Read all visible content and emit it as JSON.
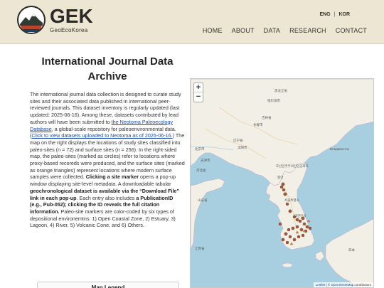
{
  "header": {
    "logo_title": "GEK",
    "logo_subtitle": "GeoEcoKorea",
    "lang": [
      "ENG",
      "KOR"
    ],
    "lang_sep": "|",
    "nav": [
      "HOME",
      "ABOUT",
      "DATA",
      "RESEARCH",
      "CONTACT"
    ]
  },
  "main": {
    "title": "International Journal Data Archive",
    "p1": "The international journal data collection is designed to curate study sites and their associated data published in international peer-reviewed journals. This dataset inventory is regularly updated (last updated: 2025-06-16). Among these, datasets contributed by lead authors will have been submitted to ",
    "neotoma_link": "the Neotoma Paleoecology Database",
    "p2": ", a global-scale repository for paleoenvironmental data. (",
    "neotoma_view_link": "Click to view datasets uploaded to Neotoma as of 2025-06-16.",
    "p3": ") The map on the right displays the locations of study sites classified into paleo-sites (n = 72) and surface sites (n = 256). In the right-sided map, the paleo-sites (marked as circles) refer to locations where proxy-based recoreds were produced, and the surface sites (marked as orange triangles) represent locations where modern surface samples were collected. ",
    "b1": "Clicking a site marker",
    "p4": " opens a pop-up window displaying site-level metadata. A downloadable tabular ",
    "b2": "geochronological dataset is available via the “Download File” link in each pop-up",
    "p5": ". Each entry also includes ",
    "b3": "a PublicationID (e.g., Pub-052); clicking the ID reveals the full citation information.",
    "p6": " Paleo-site markers are color-coded by six types of depositional environemtns: 1) Open Coastal Zone, 2) Estuary, 3) Lagoon, 4) River, 5) Volcanic Cone, and 6) Others.",
    "legend_heading": "Map Legend"
  },
  "map": {
    "zoom_in": "+",
    "zoom_out": "−",
    "attribution_leaflet": "Leaflet",
    "attribution_sep": " | © ",
    "attribution_osm": "OpenStreetMap",
    "attribution_tail": " contributors",
    "labels": [
      "黑龙江省",
      "哈尔滨市",
      "吉林省",
      "长春市",
      "辽宁省",
      "沈阳市",
      "北京市",
      "天津市",
      "河北省",
      "山东省",
      "조선민주주의인민공화국",
      "평양",
      "서울특별시",
      "대한민국",
      "日本",
      "江苏省",
      "Владивосток"
    ],
    "marker_color": "#a05a3c",
    "land_color": "#f2efe6",
    "sea_color": "#a8cfe0"
  }
}
